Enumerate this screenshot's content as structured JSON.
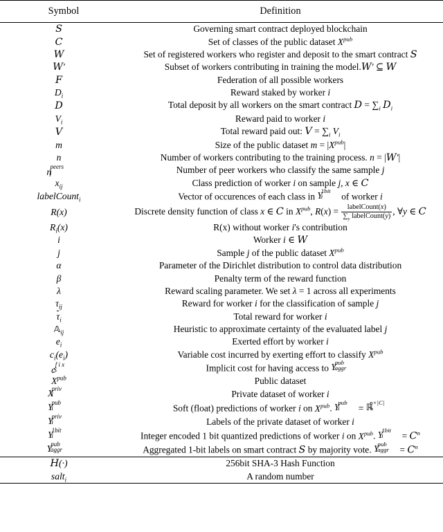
{
  "table": {
    "headers": {
      "symbol": "Symbol",
      "definition": "Definition"
    },
    "rows": [
      {
        "symbol": "S",
        "symbol_text": "S",
        "definition": "Governing smart contract deployed blockchain"
      },
      {
        "symbol": "C",
        "symbol_text": "C",
        "definition": "Set of classes of the public dataset X^pub"
      },
      {
        "symbol": "W",
        "symbol_text": "W",
        "definition": "Set of registered workers who register and deposit to the smart contract S"
      },
      {
        "symbol": "W'",
        "symbol_text": "W'",
        "definition": "Subset of workers contributing in training the model. W' ⊆ W"
      },
      {
        "symbol": "F",
        "symbol_text": "F",
        "definition": "Federation of all possible workers"
      },
      {
        "symbol": "D_i",
        "symbol_text": "D_i",
        "definition": "Reward staked by worker i"
      },
      {
        "symbol": "D",
        "symbol_text": "D",
        "definition": "Total deposit by all workers on the smart contract D = ∑_i D_i"
      },
      {
        "symbol": "V_i",
        "symbol_text": "V_i",
        "definition": "Reward paid to worker i"
      },
      {
        "symbol": "V",
        "symbol_text": "V",
        "definition": "Total reward paid out: V = ∑_i V_i"
      },
      {
        "symbol": "m",
        "symbol_text": "m",
        "definition": "Size of the public dataset m = |X^pub|"
      },
      {
        "symbol": "n",
        "symbol_text": "n",
        "definition": "Number of workers contributing to the training process. n = |W'|"
      },
      {
        "symbol": "n_j^peers",
        "symbol_text": "n_j^peers",
        "definition": "Number of peer workers who classify the same sample j"
      },
      {
        "symbol": "x_ij",
        "symbol_text": "x_ij",
        "definition": "Class prediction of worker i on sample j, x ∈ C"
      },
      {
        "symbol": "labelCount_i",
        "symbol_text": "labelCount_i",
        "definition": "Vector of occurences of each class in Y_i^1bit of worker i"
      },
      {
        "symbol": "R(x)",
        "symbol_text": "R(x)",
        "definition": "Discrete density function of class x ∈ C in X^pub, R(x) = labelCount(x) / ∑_y labelCount(y), ∀y ∈ C"
      },
      {
        "symbol": "R_i(x)",
        "symbol_text": "R_i(x)",
        "definition": "R(x) without worker i's contribution"
      },
      {
        "symbol": "i",
        "symbol_text": "i",
        "definition": "Worker i ∈ W"
      },
      {
        "symbol": "j",
        "symbol_text": "j",
        "definition": "Sample j of the public dataset X^pub"
      },
      {
        "symbol": "alpha",
        "symbol_text": "α",
        "definition": "Parameter of the Dirichlet distribution to control data distribution"
      },
      {
        "symbol": "beta",
        "symbol_text": "β",
        "definition": "Penalty term of the reward function"
      },
      {
        "symbol": "lambda",
        "symbol_text": "λ",
        "definition": "Reward scaling parameter. We set λ = 1 across all experiments"
      },
      {
        "symbol": "tau_ij",
        "symbol_text": "τ_ij",
        "definition": "Reward for worker i for the classification of sample j"
      },
      {
        "symbol": "tau_bar_i",
        "symbol_text": "τ̄_i",
        "definition": "Total reward for worker i"
      },
      {
        "symbol": "A_ij",
        "symbol_text": "𝔸_ij",
        "definition": "Heuristic to approximate certainty of the evaluated label j"
      },
      {
        "symbol": "e_i",
        "symbol_text": "e_i",
        "definition": "Exerted effort by worker i"
      },
      {
        "symbol": "c_i(e_i)",
        "symbol_text": "c_i(e_i)",
        "definition": "Variable cost incurred by exerting effort to classify X^pub"
      },
      {
        "symbol": "c_S^fix",
        "symbol_text": "c_S^fix",
        "definition": "Implicit cost for having access to Y_aggr^pub"
      },
      {
        "symbol": "X^pub",
        "symbol_text": "X^pub",
        "definition": "Public dataset"
      },
      {
        "symbol": "X_i^priv",
        "symbol_text": "X_i^priv",
        "definition": "Private dataset of worker i"
      },
      {
        "symbol": "Y_i^pub",
        "symbol_text": "Y_i^pub",
        "definition": "Soft (float) predictions of worker i on X^pub. Y_i^pub = ℝ₊^{n×|C|}"
      },
      {
        "symbol": "Y_i^priv",
        "symbol_text": "Y_i^priv",
        "definition": "Labels of the private dataset of worker i"
      },
      {
        "symbol": "Y_i^1bit",
        "symbol_text": "Y_i^1bit",
        "definition": "Integer encoded 1 bit quantized predictions of worker i on X^pub. Y_i^1bit = C^n"
      },
      {
        "symbol": "Y_aggr^pub",
        "symbol_text": "Y_aggr^pub",
        "definition": "Aggregated 1-bit labels on smart contract S by majority vote. Y_aggr^pub = C^n"
      }
    ],
    "footer_rows": [
      {
        "symbol": "H(·)",
        "symbol_text": "ℋ(·)",
        "definition": "256bit SHA-3 Hash Function"
      },
      {
        "symbol": "salt_i",
        "symbol_text": "salt_i",
        "definition": "A random number"
      }
    ]
  }
}
